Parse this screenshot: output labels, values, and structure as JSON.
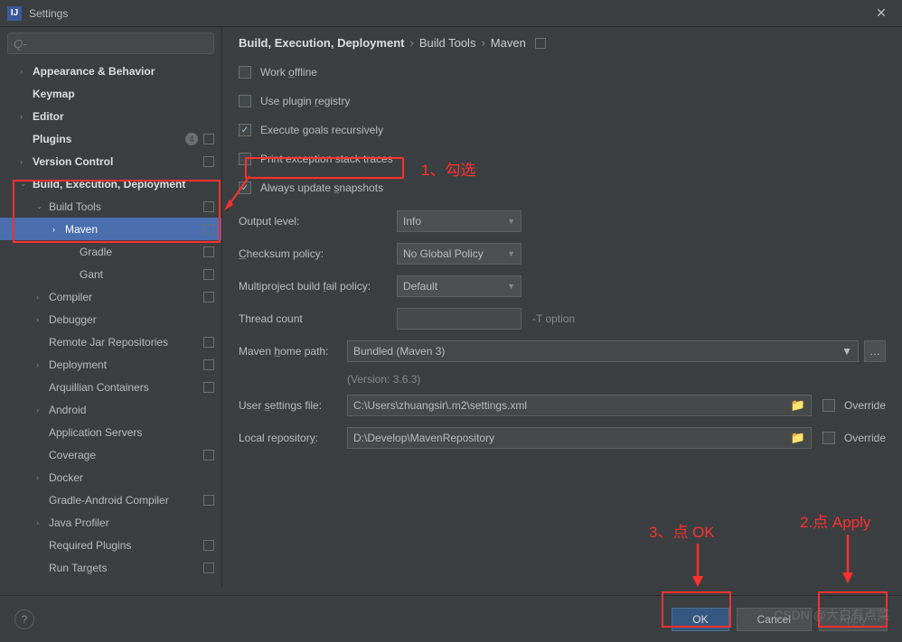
{
  "window": {
    "title": "Settings"
  },
  "search": {
    "placeholder": "Q-"
  },
  "sidebar": {
    "items": [
      {
        "label": "Appearance & Behavior",
        "bold": true,
        "chev": "›",
        "box": false
      },
      {
        "label": "Keymap",
        "bold": true,
        "chev": "",
        "box": false
      },
      {
        "label": "Editor",
        "bold": true,
        "chev": "›",
        "box": false
      },
      {
        "label": "Plugins",
        "bold": true,
        "chev": "",
        "badge": "4",
        "box": true
      },
      {
        "label": "Version Control",
        "bold": true,
        "chev": "›",
        "box": true
      },
      {
        "label": "Build, Execution, Deployment",
        "bold": true,
        "chev": "⌄",
        "box": false
      },
      {
        "label": "Build Tools",
        "bold": false,
        "chev": "⌄",
        "lvl": "l2",
        "box": true
      },
      {
        "label": "Maven",
        "bold": false,
        "chev": "›",
        "lvl": "l3",
        "selected": true,
        "box": true
      },
      {
        "label": "Gradle",
        "bold": false,
        "chev": "",
        "lvl": "l4",
        "box": true
      },
      {
        "label": "Gant",
        "bold": false,
        "chev": "",
        "lvl": "l4",
        "box": true
      },
      {
        "label": "Compiler",
        "bold": false,
        "chev": "›",
        "lvl": "l2",
        "box": true
      },
      {
        "label": "Debugger",
        "bold": false,
        "chev": "›",
        "lvl": "l2",
        "box": false
      },
      {
        "label": "Remote Jar Repositories",
        "bold": false,
        "chev": "",
        "lvl": "l2",
        "box": true
      },
      {
        "label": "Deployment",
        "bold": false,
        "chev": "›",
        "lvl": "l2",
        "box": true
      },
      {
        "label": "Arquillian Containers",
        "bold": false,
        "chev": "",
        "lvl": "l2",
        "box": true
      },
      {
        "label": "Android",
        "bold": false,
        "chev": "›",
        "lvl": "l2",
        "box": false
      },
      {
        "label": "Application Servers",
        "bold": false,
        "chev": "",
        "lvl": "l2",
        "box": false
      },
      {
        "label": "Coverage",
        "bold": false,
        "chev": "",
        "lvl": "l2",
        "box": true
      },
      {
        "label": "Docker",
        "bold": false,
        "chev": "›",
        "lvl": "l2",
        "box": false
      },
      {
        "label": "Gradle-Android Compiler",
        "bold": false,
        "chev": "",
        "lvl": "l2",
        "box": true
      },
      {
        "label": "Java Profiler",
        "bold": false,
        "chev": "›",
        "lvl": "l2",
        "box": false
      },
      {
        "label": "Required Plugins",
        "bold": false,
        "chev": "",
        "lvl": "l2",
        "box": true
      },
      {
        "label": "Run Targets",
        "bold": false,
        "chev": "",
        "lvl": "l2",
        "box": true
      }
    ]
  },
  "breadcrumb": {
    "p1": "Build, Execution, Deployment",
    "p2": "Build Tools",
    "p3": "Maven"
  },
  "checkboxes": {
    "work_offline": {
      "label": "Work offline",
      "checked": false,
      "u": "o"
    },
    "plugin_registry": {
      "label": "Use plugin registry",
      "checked": false,
      "u": "r"
    },
    "exec_goals": {
      "label": "Execute goals recursively",
      "checked": true,
      "u": "g"
    },
    "print_exc": {
      "label": "Print exception stack traces",
      "checked": false,
      "u": ""
    },
    "always_update": {
      "label": "Always update snapshots",
      "checked": true,
      "u": "s"
    }
  },
  "form": {
    "output_level": {
      "label": "Output level:",
      "value": "Info"
    },
    "checksum": {
      "label": "Checksum policy:",
      "value": "No Global Policy"
    },
    "multiproject": {
      "label": "Multiproject build fail policy:",
      "value": "Default",
      "u": "f"
    },
    "thread_count": {
      "label": "Thread count",
      "value": "",
      "hint": "-T option"
    },
    "home_path": {
      "label": "Maven home path:",
      "value": "Bundled (Maven 3)",
      "u": "h"
    },
    "version": "(Version: 3.6.3)",
    "user_settings": {
      "label": "User settings file:",
      "value": "C:\\Users\\zhuangsir\\.m2\\settings.xml",
      "u": "s"
    },
    "local_repo": {
      "label": "Local repository:",
      "value": "D:\\Develop\\MavenRepository",
      "u": "y"
    },
    "override": "Override"
  },
  "footer": {
    "ok": "OK",
    "cancel": "Cancel",
    "apply": "Apply"
  },
  "annotations": {
    "a1": "1、勾选",
    "a2": "2.点 Apply",
    "a3": "3、点 OK"
  },
  "watermark": "CSDN @大白有点菜"
}
